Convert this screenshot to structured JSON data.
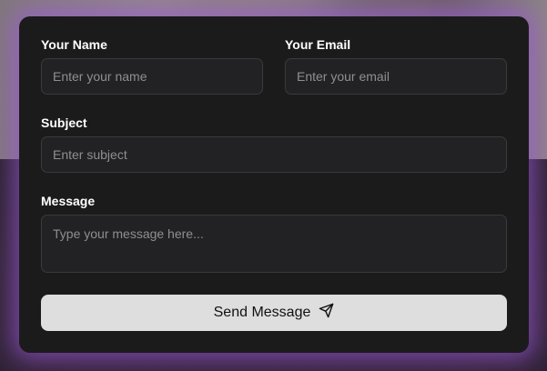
{
  "form": {
    "name": {
      "label": "Your Name",
      "placeholder": "Enter your name"
    },
    "email": {
      "label": "Your Email",
      "placeholder": "Enter your email"
    },
    "subject": {
      "label": "Subject",
      "placeholder": "Enter subject"
    },
    "message": {
      "label": "Message",
      "placeholder": "Type your message here..."
    },
    "submit": {
      "label": "Send Message",
      "icon": "send-icon"
    }
  },
  "colors": {
    "card_bg": "#1b1b1c",
    "field_bg": "#222224",
    "button_bg": "#dedede",
    "glow": "#965adc"
  }
}
